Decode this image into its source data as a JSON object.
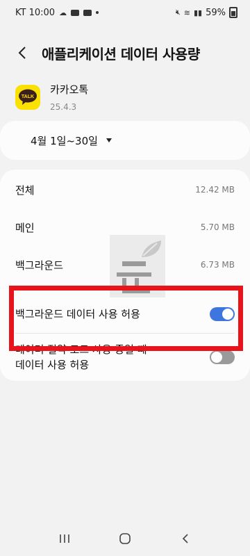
{
  "status_bar": {
    "carrier_time": "KT 10:00",
    "battery": "59%"
  },
  "header": {
    "title": "애플리케이션 데이터 사용량"
  },
  "app": {
    "name": "카카오톡",
    "version": "25.4.3",
    "icon_text": "TALK",
    "icon_color": "#fae100"
  },
  "date_range": {
    "label": "4월 1일~30일"
  },
  "usage": {
    "total": {
      "label": "전체",
      "value": "12.42 MB"
    },
    "foreground": {
      "label": "메인",
      "value": "5.70 MB"
    },
    "background": {
      "label": "백그라운드",
      "value": "6.73 MB"
    }
  },
  "toggles": {
    "background_data": {
      "label": "백그라운드 데이터 사용 허용",
      "state": "on"
    },
    "data_saver": {
      "label_line1": "데이터 절약 모드 사용 중일 때",
      "label_line2": "데이터 사용 허용",
      "state": "off"
    }
  },
  "colors": {
    "accent": "#3e76e0",
    "highlight": "#e8141b"
  }
}
